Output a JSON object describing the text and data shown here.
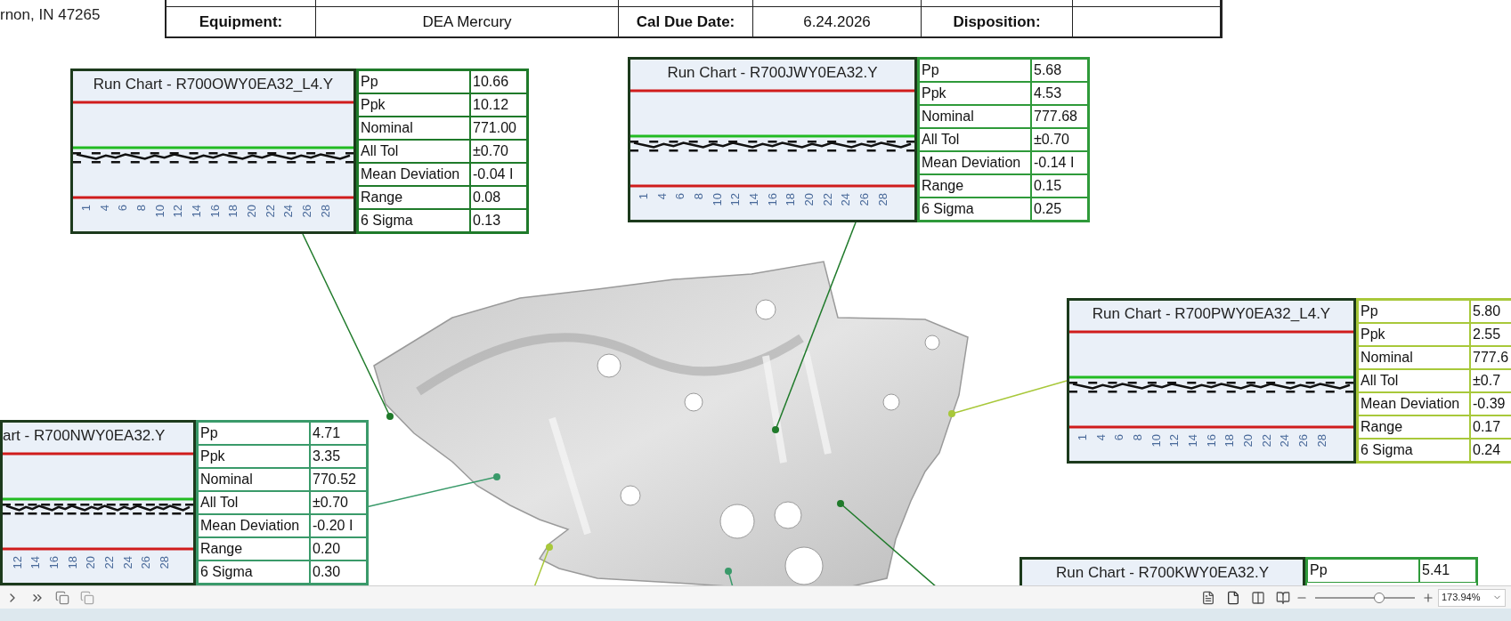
{
  "address": "rnon, IN 47265",
  "header_row": [
    {
      "kind": "label",
      "text": "Equipment:"
    },
    {
      "kind": "value",
      "text": "DEA Mercury"
    },
    {
      "kind": "label",
      "text": "Cal Due Date:"
    },
    {
      "kind": "value",
      "text": "6.24.2026"
    },
    {
      "kind": "label",
      "text": "Disposition:"
    },
    {
      "kind": "blank"
    }
  ],
  "callouts": [
    {
      "title": "Run Chart - R700OWY0EA32_L4.Y",
      "color": "#1f7a2a",
      "x_labels": [
        "1",
        "4",
        "6",
        "8",
        "10",
        "12",
        "14",
        "16",
        "18",
        "20",
        "22",
        "24",
        "26",
        "28"
      ],
      "stats": [
        {
          "label": "Pp",
          "value": "10.66"
        },
        {
          "label": "Ppk",
          "value": "10.12"
        },
        {
          "label": "Nominal",
          "value": "771.00"
        },
        {
          "label": "All Tol",
          "value": "±0.70"
        },
        {
          "label": "Mean Deviation",
          "value": "-0.04 I"
        },
        {
          "label": "Range",
          "value": "0.08"
        },
        {
          "label": "6 Sigma",
          "value": "0.13"
        }
      ]
    },
    {
      "title": "Run Chart - R700JWY0EA32.Y",
      "color": "#2f9a3a",
      "x_labels": [
        "1",
        "4",
        "6",
        "8",
        "10",
        "12",
        "14",
        "16",
        "18",
        "20",
        "22",
        "24",
        "26",
        "28"
      ],
      "stats": [
        {
          "label": "Pp",
          "value": "5.68"
        },
        {
          "label": "Ppk",
          "value": "4.53"
        },
        {
          "label": "Nominal",
          "value": "777.68"
        },
        {
          "label": "All Tol",
          "value": "±0.70"
        },
        {
          "label": "Mean Deviation",
          "value": "-0.14 I"
        },
        {
          "label": "Range",
          "value": "0.15"
        },
        {
          "label": "6 Sigma",
          "value": "0.25"
        }
      ]
    },
    {
      "title": "Run Chart - R700PWY0EA32_L4.Y",
      "color": "#a8c83a",
      "x_labels": [
        "1",
        "4",
        "6",
        "8",
        "10",
        "12",
        "14",
        "16",
        "18",
        "20",
        "22",
        "24",
        "26",
        "28"
      ],
      "stats": [
        {
          "label": "Pp",
          "value": "5.80"
        },
        {
          "label": "Ppk",
          "value": "2.55"
        },
        {
          "label": "Nominal",
          "value": "777.6"
        },
        {
          "label": "All Tol",
          "value": "±0.7"
        },
        {
          "label": "Mean Deviation",
          "value": "-0.39"
        },
        {
          "label": "Range",
          "value": "0.17"
        },
        {
          "label": "6 Sigma",
          "value": "0.24"
        }
      ]
    },
    {
      "title": "art - R700NWY0EA32.Y",
      "cut_left": true,
      "color": "#3a9a6a",
      "x_labels": [
        "12",
        "14",
        "16",
        "18",
        "20",
        "22",
        "24",
        "26",
        "28"
      ],
      "stats": [
        {
          "label": "Pp",
          "value": "4.71"
        },
        {
          "label": "Ppk",
          "value": "3.35"
        },
        {
          "label": "Nominal",
          "value": "770.52"
        },
        {
          "label": "All Tol",
          "value": "±0.70"
        },
        {
          "label": "Mean Deviation",
          "value": "-0.20 I"
        },
        {
          "label": "Range",
          "value": "0.20"
        },
        {
          "label": "6 Sigma",
          "value": "0.30"
        }
      ]
    },
    {
      "title": "Run Chart - R700KWY0EA32.Y",
      "color": "#2f9a3a",
      "stats": [
        {
          "label": "Pp",
          "value": "5.41"
        }
      ]
    }
  ],
  "zoom_slider": {
    "level": 0.64
  },
  "zoom_field": {
    "value": "173.94%"
  }
}
